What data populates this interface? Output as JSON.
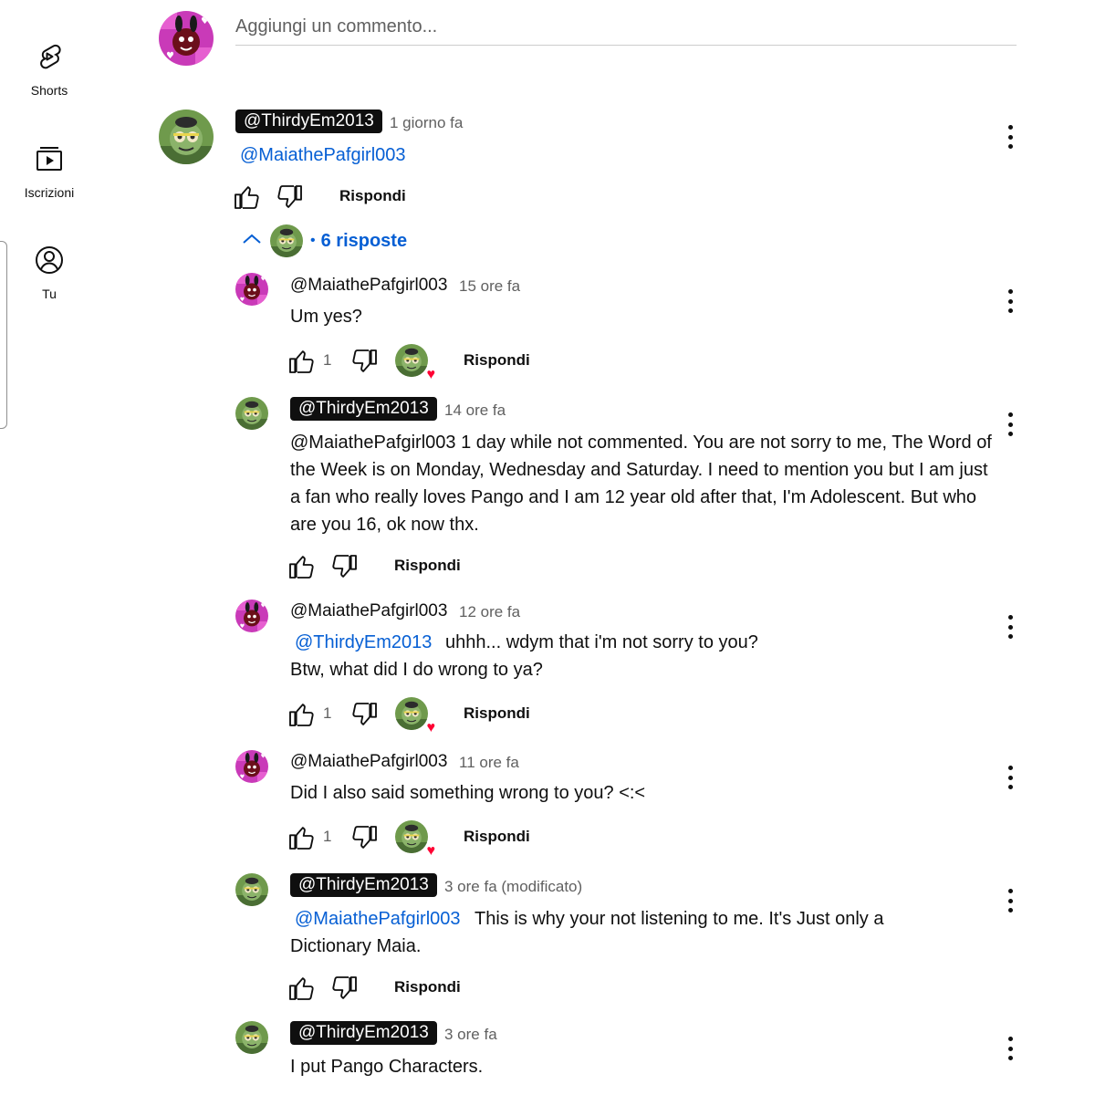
{
  "sidebar": {
    "items": [
      {
        "label": "Shorts",
        "icon": "shorts-icon"
      },
      {
        "label": "Iscrizioni",
        "icon": "subscriptions-icon"
      },
      {
        "label": "Tu",
        "icon": "you-icon"
      }
    ]
  },
  "add_comment": {
    "placeholder": "Aggiungi un commento..."
  },
  "top_comment": {
    "author": "@ThirdyEm2013",
    "time": "1 giorno fa",
    "mention": "@MaiathePafgirl003",
    "reply_label": "Rispondi"
  },
  "replies_toggle": {
    "label": "6 risposte"
  },
  "replies": [
    {
      "author": "@MaiathePafgirl003",
      "time": "15 ore fa",
      "text": "Um yes?",
      "likes": "1",
      "reply_label": "Rispondi"
    },
    {
      "author": "@ThirdyEm2013",
      "time": "14 ore fa",
      "text": "@MaiathePafgirl003 1 day while not commented. You are not sorry to me, The Word of the Week is on Monday, Wednesday and Saturday. I need to mention you but I am just a fan who really loves Pango and I am 12 year old after that, I'm Adolescent. But who are you 16, ok now thx.",
      "reply_label": "Rispondi"
    },
    {
      "author": "@MaiathePafgirl003",
      "time": "12 ore fa",
      "mention": "@ThirdyEm2013",
      "text_line1": "uhhh... wdym that i'm not sorry to you?",
      "text_line2": "Btw, what did I do wrong to ya?",
      "likes": "1",
      "reply_label": "Rispondi"
    },
    {
      "author": "@MaiathePafgirl003",
      "time": "11 ore fa",
      "text": "Did I also said something wrong to you? <:<",
      "likes": "1",
      "reply_label": "Rispondi"
    },
    {
      "author": "@ThirdyEm2013",
      "time": "3 ore fa (modificato)",
      "mention": "@MaiathePafgirl003",
      "text_line1": "This is why your not listening to me. It's Just only a",
      "text_line2": "Dictionary Maia.",
      "reply_label": "Rispondi"
    },
    {
      "author": "@ThirdyEm2013",
      "time": "3 ore fa",
      "text": "I put Pango Characters."
    }
  ],
  "colors": {
    "mention": "#065fd4",
    "heart": "#ff0033",
    "pill": "#0f0f0f"
  }
}
